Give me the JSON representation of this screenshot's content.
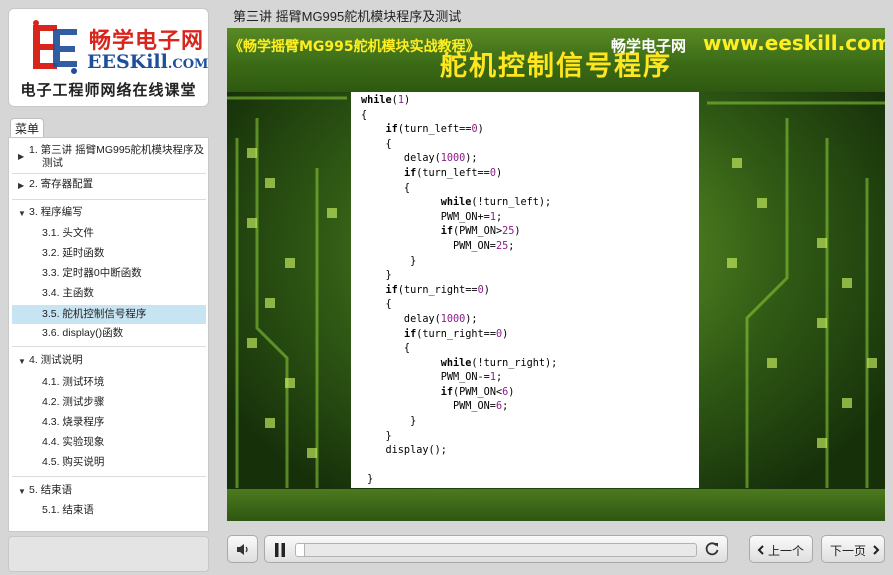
{
  "brand": {
    "name_cn": "畅学电子网",
    "name_en": "EESKill",
    "name_en_domain": ".COM",
    "tagline": "电子工程师网络在线课堂",
    "logo_letters": "EE",
    "color_red": "#d9261c",
    "color_blue": "#1f4f9a"
  },
  "menu": {
    "tab_label": "菜单",
    "items": [
      {
        "label": "1. 第三讲 摇臂MG995舵机模块程序及",
        "label2": "测试",
        "expanded": false
      },
      {
        "label": "2. 寄存器配置",
        "expanded": false
      },
      {
        "label": "3. 程序编写",
        "expanded": true,
        "children": [
          "3.1. 头文件",
          "3.2. 延时函数",
          "3.3. 定时器0中断函数",
          "3.4. 主函数",
          "3.5. 舵机控制信号程序",
          "3.6. display()函数"
        ]
      },
      {
        "label": "4. 测试说明",
        "expanded": true,
        "children": [
          "4.1. 测试环境",
          "4.2. 测试步骤",
          "4.3. 烧录程序",
          "4.4. 实验现象",
          "4.5. 购买说明"
        ]
      },
      {
        "label": "5. 结束语",
        "expanded": true,
        "children": [
          "5.1. 结束语"
        ]
      }
    ],
    "active_item": "3.5. 舵机控制信号程序",
    "active_color": "#c7e4f2"
  },
  "slide": {
    "title": "第三讲 摇臂MG995舵机模块程序及测试",
    "heading": "舵机控制信号程序",
    "heading_color": "#ffe61e",
    "footer_left": "《畅学摇臂MG995舵机模块实战教程》",
    "footer_cn": "畅学电子网",
    "footer_url": "www.eeskill.com",
    "code_lines": [
      {
        "i": 0,
        "t": "while(1)"
      },
      {
        "i": 0,
        "t": "{"
      },
      {
        "i": 4,
        "t": "if(turn_left==0)"
      },
      {
        "i": 4,
        "t": "{"
      },
      {
        "i": 7,
        "t": "delay(1000);"
      },
      {
        "i": 7,
        "t": "if(turn_left==0)"
      },
      {
        "i": 7,
        "t": "{"
      },
      {
        "i": 13,
        "t": "while(!turn_left);"
      },
      {
        "i": 13,
        "t": "PWM_ON+=1;"
      },
      {
        "i": 13,
        "t": "if(PWM_ON>25)"
      },
      {
        "i": 15,
        "t": "PWM_ON=25;"
      },
      {
        "i": 8,
        "t": "}"
      },
      {
        "i": 4,
        "t": "}"
      },
      {
        "i": 4,
        "t": "if(turn_right==0)"
      },
      {
        "i": 4,
        "t": "{"
      },
      {
        "i": 7,
        "t": "delay(1000);"
      },
      {
        "i": 7,
        "t": "if(turn_right==0)"
      },
      {
        "i": 7,
        "t": "{"
      },
      {
        "i": 13,
        "t": "while(!turn_right);"
      },
      {
        "i": 13,
        "t": "PWM_ON-=1;"
      },
      {
        "i": 13,
        "t": "if(PWM_ON<6)"
      },
      {
        "i": 15,
        "t": "PWM_ON=6;"
      },
      {
        "i": 8,
        "t": "}"
      },
      {
        "i": 4,
        "t": "}"
      },
      {
        "i": 4,
        "t": "display();"
      },
      {
        "i": 0,
        "t": ""
      },
      {
        "i": 1,
        "t": "}"
      }
    ]
  },
  "player": {
    "progress": 0.02,
    "prev_label": "上一个",
    "next_label": "下一页",
    "volume_icon": "speaker-icon",
    "pause_icon": "pause-icon",
    "replay_icon": "replay-icon"
  }
}
